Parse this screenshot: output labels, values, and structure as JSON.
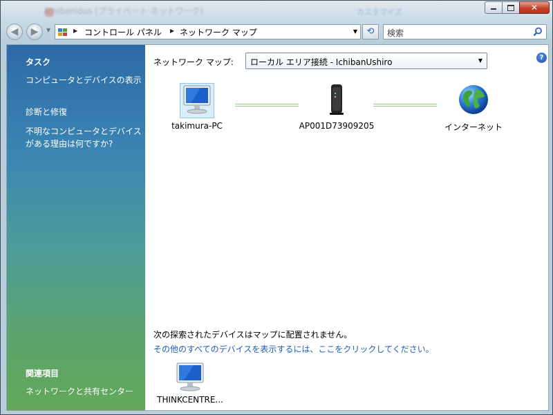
{
  "window": {
    "ghost_title": "Ichibanidos (プライベート ネットワーク)",
    "ghost_link": "カスタマイズ"
  },
  "navbar": {
    "breadcrumbs": [
      "コントロール パネル",
      "ネットワーク マップ"
    ],
    "search_placeholder": "検索"
  },
  "sidebar": {
    "tasks_heading": "タスク",
    "tasks": [
      "コンピュータとデバイスの表示",
      "診断と修復",
      "不明なコンピュータとデバイスがある理由は何ですか?"
    ],
    "related_heading": "関連項目",
    "related": [
      "ネットワークと共有センター"
    ]
  },
  "main": {
    "map_label": "ネットワーク マップ:",
    "connection": "ローカル エリア接続 - IchibanUshiro",
    "nodes": [
      {
        "name": "takimura-PC",
        "icon": "computer-icon"
      },
      {
        "name": "AP001D73909205",
        "icon": "router-icon"
      },
      {
        "name": "インターネット",
        "icon": "globe-icon"
      }
    ],
    "unplaced_message": "次の探索されたデバイスはマップに配置されません。",
    "show_all_link": "その他のすべてのデバイスを表示するには、ここをクリックしてください。",
    "unplaced_devices": [
      {
        "name": "THINKCENTRE...",
        "icon": "computer-icon"
      }
    ]
  },
  "colors": {
    "link": "#1a5fb4",
    "connection_line": "#98cf86"
  }
}
